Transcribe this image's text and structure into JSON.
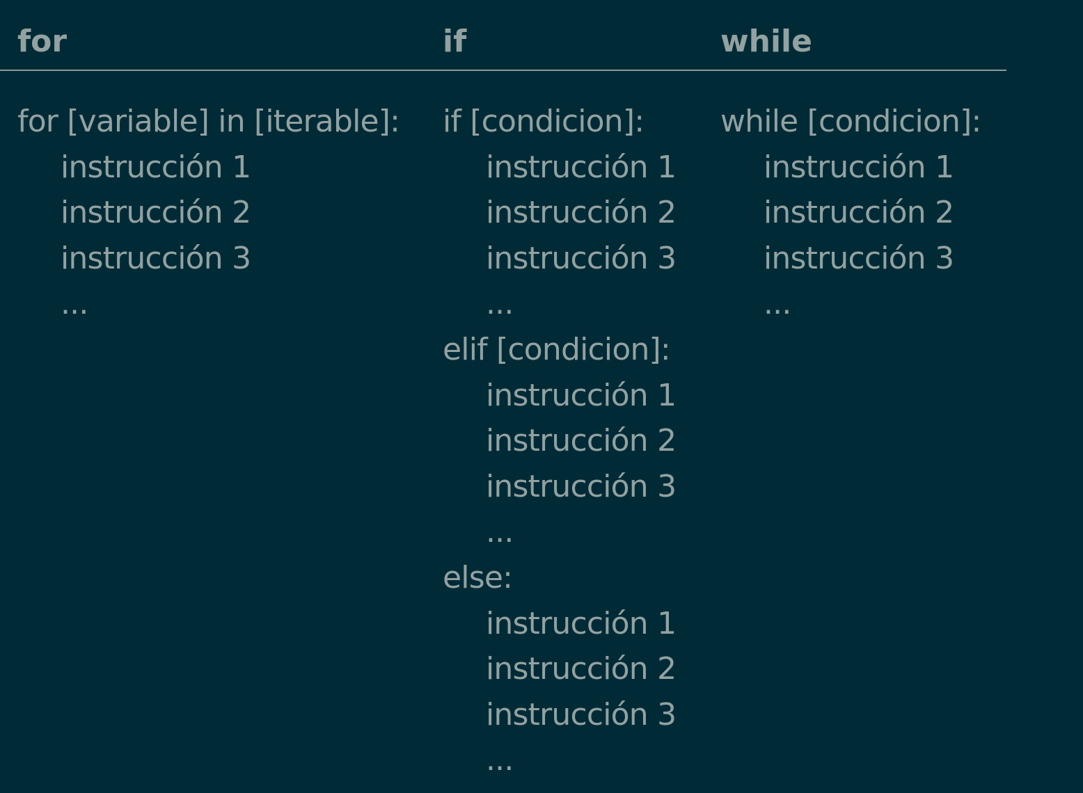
{
  "headers": {
    "for": "for",
    "if": "if",
    "while": "while"
  },
  "for_col": {
    "lines": [
      "for [variable] in [iterable]:",
      "instrucción 1",
      "instrucción 2",
      "instrucción 3",
      "..."
    ]
  },
  "if_col": {
    "lines": [
      "if [condicion]:",
      "instrucción 1",
      "instrucción 2",
      "instrucción 3",
      "...",
      "elif [condicion]:",
      "instrucción 1",
      "instrucción 2",
      "instrucción 3",
      "...",
      "else:",
      "instrucción 1",
      "instrucción 2",
      "instrucción 3",
      "..."
    ]
  },
  "while_col": {
    "lines": [
      "while [condicion]:",
      "instrucción 1",
      "instrucción 2",
      "instrucción 3",
      "..."
    ]
  }
}
